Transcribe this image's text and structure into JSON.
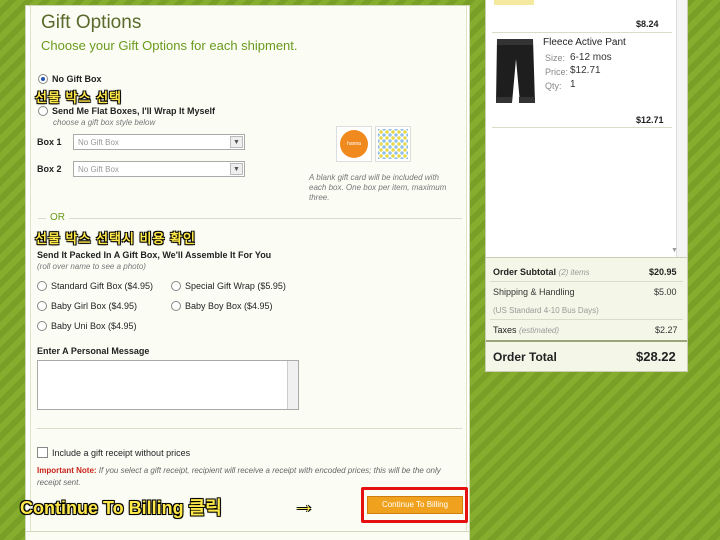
{
  "gift_options": {
    "title": "Gift Options",
    "subtitle": "Choose your Gift Options for each shipment.",
    "no_gift_box": "No Gift Box",
    "annotation_select_box": "선물 박스 선택",
    "flat_boxes_label": "Send Me Flat Boxes, I'll Wrap It Myself",
    "flat_boxes_hint": "choose a gift box style below",
    "box1_label": "Box 1",
    "box2_label": "Box 2",
    "box1_value": "No Gift Box",
    "box2_value": "No Gift Box",
    "gift_card_note": "A blank gift card will be included with each box. One box per item, maximum three.",
    "gift_card_logo": "hanna",
    "or_label": "OR",
    "annotation_cost_check": "선물 박스 선택시 비용 확인",
    "packed_label": "Send It Packed In A Gift Box, We'll Assemble It For You",
    "packed_hint": "(roll over name to see a photo)",
    "box_choices": [
      "Standard Gift Box ($4.95)",
      "Special Gift Wrap ($5.95)",
      "Baby Girl Box ($4.95)",
      "Baby Boy Box ($4.95)",
      "Baby Uni Box ($4.95)"
    ],
    "message_label": "Enter A Personal Message",
    "receipt_label": "Include a gift receipt without prices",
    "important_label": "Important Note:",
    "important_text": "If you select a gift receipt, recipient will receive a receipt with encoded prices; this will be the only receipt sent.",
    "annotation_continue": "Continue To Billing 클릭",
    "arrow": "→",
    "continue_button": "Continue To Billing"
  },
  "cart": {
    "top_item_price": "$8.24",
    "item": {
      "name": "Fleece Active Pant",
      "size_label": "Size:",
      "size_value": "6-12 mos",
      "price_label": "Price:",
      "price_value": "$12.71",
      "qty_label": "Qty:",
      "qty_value": "1",
      "line_total": "$12.71"
    },
    "order_subtotal_label": "Order Subtotal",
    "order_subtotal_items": "(2) items",
    "order_subtotal_value": "$20.95",
    "shipping_label": "Shipping & Handling",
    "shipping_value": "$5.00",
    "shipping_method": "(US Standard 4-10 Bus Days)",
    "taxes_label": "Taxes",
    "taxes_note": "(estimated)",
    "taxes_value": "$2.27",
    "order_total_label": "Order Total",
    "order_total_value": "$28.22"
  },
  "colors": {
    "accent_green": "#6a9a1c",
    "button_orange": "#f0a21e",
    "highlight_red": "#e51010",
    "annotation_yellow": "#ffe94a"
  }
}
